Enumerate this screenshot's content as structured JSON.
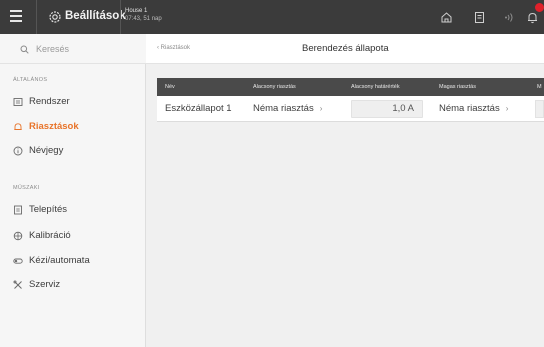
{
  "topbar": {
    "title": "Beállítások",
    "context_name": "House 1",
    "context_time": "07:43, 51 nap",
    "icons": [
      "menu-icon",
      "gear-icon",
      "home-icon",
      "document-icon",
      "signal-icon",
      "bell-icon"
    ],
    "badge_color": "#e0202a"
  },
  "sidebar": {
    "search_placeholder": "Keresés",
    "sections": [
      {
        "header": "ÁLTALÁNOS",
        "items": [
          {
            "label": "Rendszer",
            "icon": "system-icon"
          },
          {
            "label": "Riasztások",
            "icon": "alarm-icon",
            "active": true
          },
          {
            "label": "Névjegy",
            "icon": "info-icon"
          }
        ]
      },
      {
        "header": "MŰSZAKI",
        "items": [
          {
            "label": "Telepítés",
            "icon": "install-icon"
          },
          {
            "label": "Kalibráció",
            "icon": "calibration-icon"
          },
          {
            "label": "Kézi/automata",
            "icon": "toggle-icon"
          },
          {
            "label": "Szerviz",
            "icon": "wrench-icon"
          }
        ]
      }
    ],
    "active_color": "#e8742a"
  },
  "main": {
    "back_label": "Riasztások",
    "page_title": "Berendezés állapota",
    "table": {
      "columns": [
        "Név",
        "Alacsony riasztás",
        "Alacsony határérték",
        "Magas riasztás",
        "M"
      ],
      "rows": [
        {
          "name": "Eszközállapot 1",
          "low_alarm": "Néma riasztás",
          "low_limit": "1,0 A",
          "high_alarm": "Néma riasztás"
        }
      ]
    }
  }
}
